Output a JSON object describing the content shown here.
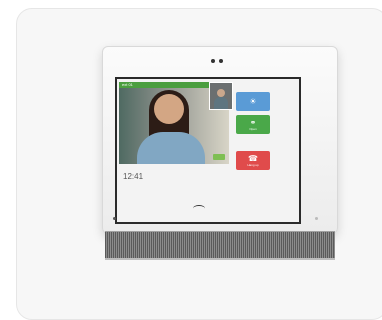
{
  "screen": {
    "video_label": "ext 01",
    "time": "12:41",
    "buttons": [
      {
        "label": "",
        "icon": "bell-icon",
        "color": "#5a9bd6"
      },
      {
        "label": "Open",
        "icon": "key-icon",
        "color": "#4aa849"
      },
      {
        "label": "Hang up",
        "icon": "phone-icon",
        "color": "#e04b4b"
      }
    ]
  }
}
